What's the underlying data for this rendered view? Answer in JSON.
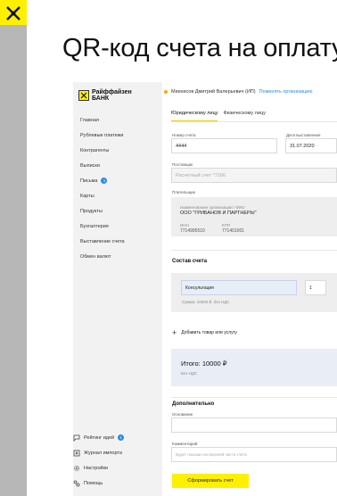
{
  "slide": {
    "title": "QR-код счета на оплату"
  },
  "brand": {
    "name_line1": "Райффайзен",
    "name_line2": "БАНК"
  },
  "sidebar": {
    "items": [
      {
        "label": "Главная"
      },
      {
        "label": "Рублевые платежи"
      },
      {
        "label": "Контрагенты"
      },
      {
        "label": "Выписки"
      },
      {
        "label": "Письма",
        "badge": "1"
      },
      {
        "label": "Карты"
      },
      {
        "label": "Продукты"
      },
      {
        "label": "Бухгалтерия"
      },
      {
        "label": "Выставление счета"
      },
      {
        "label": "Обмен валют"
      }
    ],
    "bottom_items": [
      {
        "label": "Рейтинг идей",
        "badge": "1",
        "icon": "chat-icon"
      },
      {
        "label": "Журнал импорта",
        "icon": "import-icon"
      },
      {
        "label": "Настройки",
        "icon": "gear-icon"
      },
      {
        "label": "Помощь",
        "icon": "help-icon"
      }
    ]
  },
  "topbar": {
    "user": "Михеисов Дмитрий Валерьевич (ИП)",
    "switch_link": "Поменять организацию"
  },
  "tabs": {
    "legal": "Юридическому лицу",
    "individual": "Физическому лицу"
  },
  "form": {
    "invoice_number_label": "Номер счета",
    "invoice_number_value": "4444",
    "issue_date_label": "Дата выставления",
    "issue_date_value": "31.07.2020",
    "supplier_label": "Поставщик",
    "supplier_value": "Расчетный счет *7166",
    "payer_label": "Плательщик",
    "payer_name_label": "Наименование организации / ФИО",
    "payer_name_value": "ООО \"ГРИБАНОВ И ПАРТНЕРЫ\"",
    "inn_label": "ИНН",
    "inn_value": "7714995510",
    "kpp_label": "КПП",
    "kpp_value": "771401001"
  },
  "invoice_items": {
    "section_title": "Состав счета",
    "item_name": "Консультация",
    "item_qty": "1",
    "item_sum": "Сумма: 10000 ₽, без НДС",
    "add_button": "Добавить товар или услугу"
  },
  "totals": {
    "total": "Итого: 10000 ₽",
    "vat_note": "Без НДС"
  },
  "additional": {
    "section_title": "Дополнительно",
    "basis_label": "Основание",
    "comment_label": "Комментарий",
    "comment_placeholder": "Будет показан на верхней части счета"
  },
  "submit_button": "Сформировать счет",
  "colors": {
    "brand_yellow": "#fff000",
    "accent_blue": "#2b8be0",
    "tab_underline": "#f5c400"
  }
}
